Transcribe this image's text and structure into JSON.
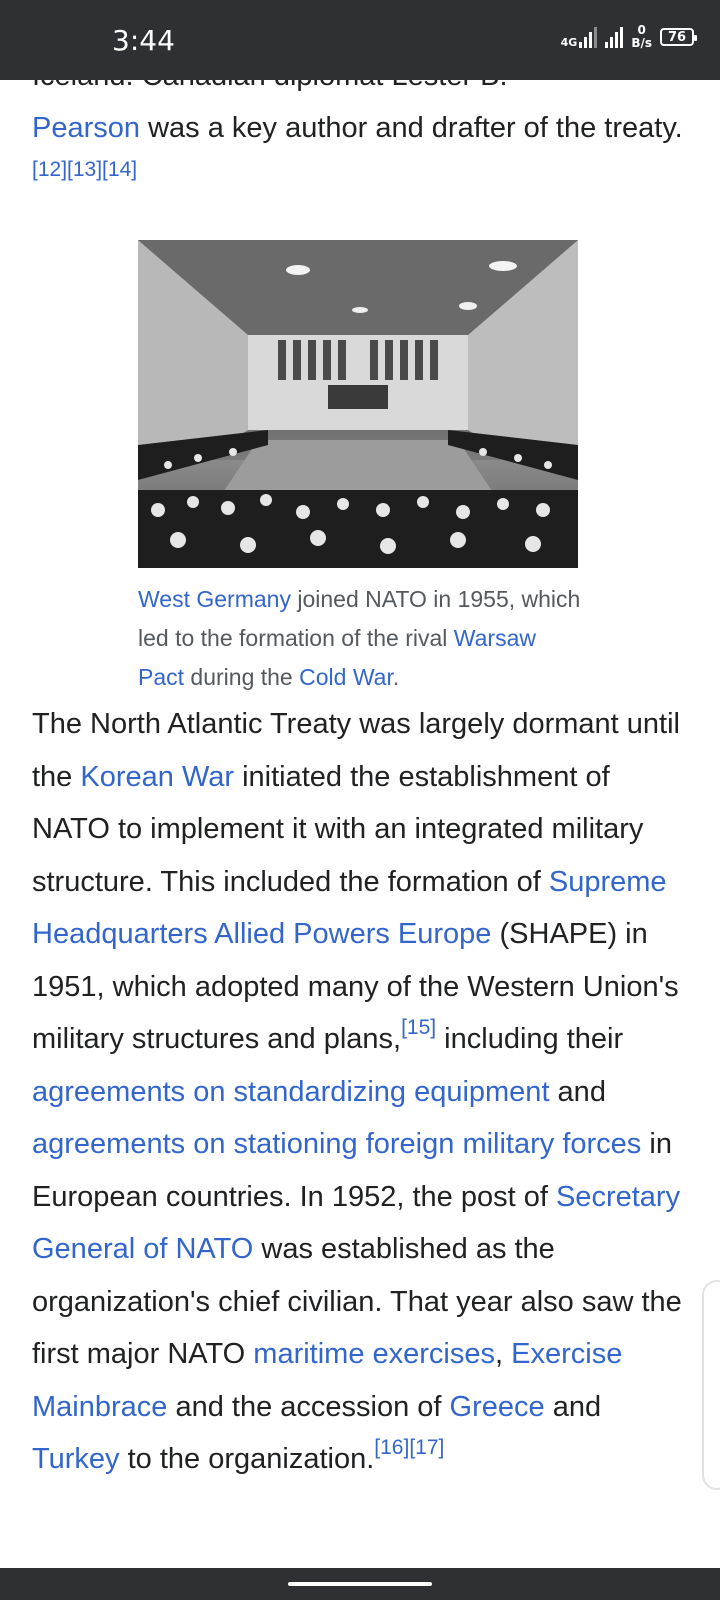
{
  "status_bar": {
    "time": "3:44",
    "network_type": "4G",
    "speed_value": "0",
    "speed_unit": "B/s",
    "battery": "76"
  },
  "article": {
    "cut_off_line": "Iceland. Canadian diplomat Lester B.",
    "para1": {
      "link_pearson": "Pearson",
      "text_a": " was a key author and drafter of the treaty.",
      "refs": "[12][13][14]"
    },
    "figure": {
      "image_alt": "Black-and-white photograph of a large conference hall with delegates seated around long tables",
      "caption": {
        "link_west_germany": "West Germany",
        "text_a": " joined NATO in 1955, which led to the formation of the rival ",
        "link_warsaw_pact": "Warsaw Pact",
        "text_b": " during the ",
        "link_cold_war": "Cold War",
        "text_c": "."
      }
    },
    "para2": {
      "t1": "The North Atlantic Treaty was largely dormant until the ",
      "link_korean_war": "Korean War",
      "t2": " initiated the establishment of NATO to implement it with an integrated military structure. This included the formation of ",
      "link_shape": "Supreme Headquarters Allied Powers Europe",
      "t3": " (SHAPE) in 1951, which adopted many of the Western Union's military structures and plans,",
      "ref15": "[15]",
      "t4": " including their ",
      "link_standardizing": "agreements on standardizing equipment",
      "t5": " and ",
      "link_stationing": "agreements on stationing foreign military forces",
      "t6": " in European countries. In 1952, the post of ",
      "link_secgen": "Secretary General of NATO",
      "t7": " was established as the organization's chief civilian. That year also saw the first major NATO ",
      "link_maritime": "maritime exercises",
      "t8": ", ",
      "link_mainbrace": "Exercise Mainbrace",
      "t9": " and the accession of ",
      "link_greece": "Greece",
      "t10": " and ",
      "link_turkey": "Turkey",
      "t11": " to the organization.",
      "refs_end": "[16][17]"
    }
  },
  "colors": {
    "link": "#3366cc",
    "text": "#202122",
    "caption_text": "#54595d",
    "status_bar_bg": "#2f3033"
  }
}
